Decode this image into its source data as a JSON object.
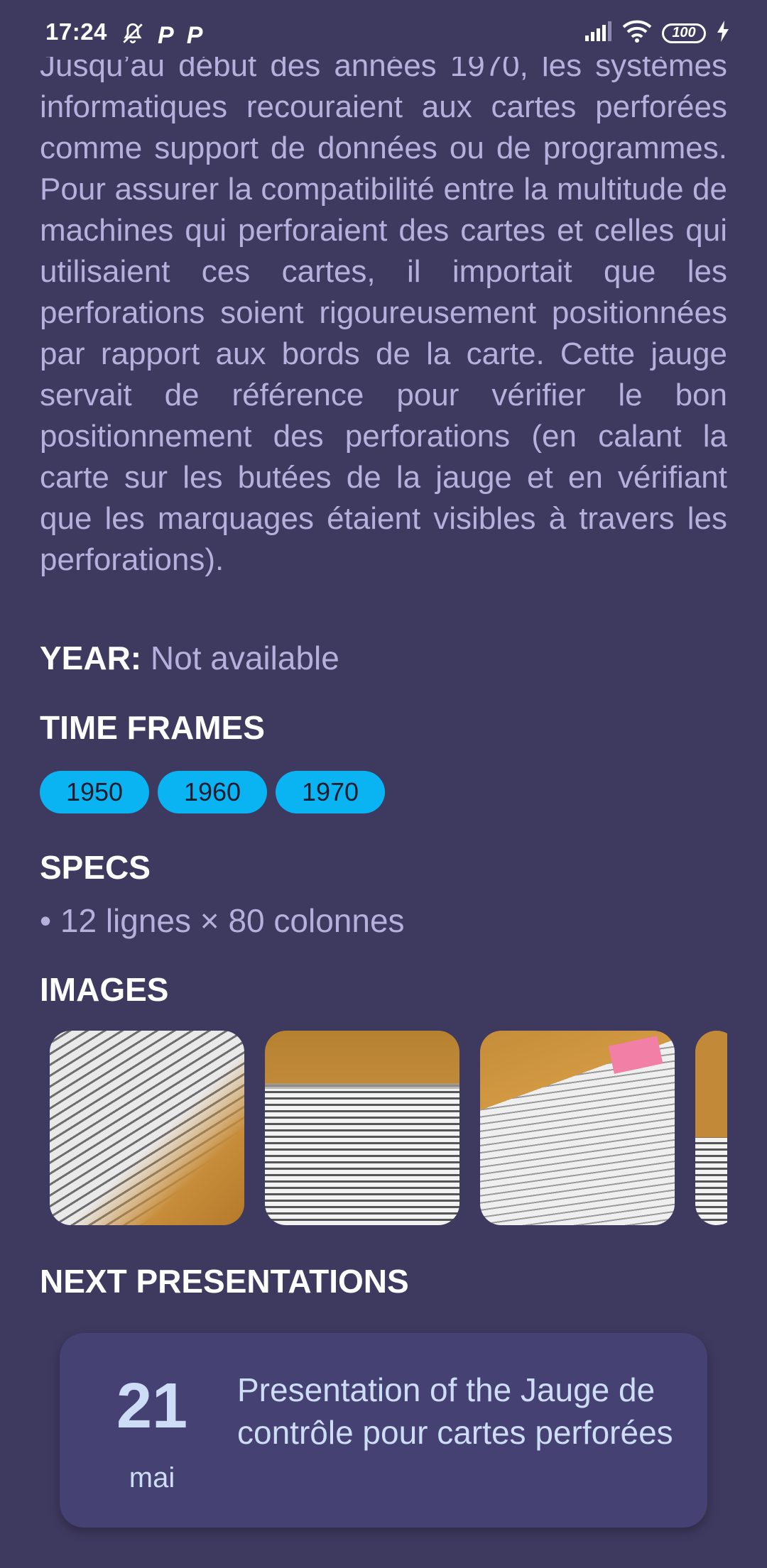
{
  "status_bar": {
    "time": "17:24",
    "battery": "100",
    "icons": [
      "mute-icon",
      "parking-icon",
      "parking-icon",
      "signal-icon",
      "wifi-icon",
      "battery-icon",
      "charging-icon"
    ]
  },
  "description": "Jusqu’au début des années 1970, les systèmes informatiques recouraient aux cartes perforées comme support de données ou de programmes. Pour assurer la compatibilité entre la multitude de machines qui perforaient des cartes et celles qui utilisaient ces cartes, il importait que les perforations soient rigoureusement positionnées par rapport aux bords de la carte. Cette jauge servait de référence pour vérifier le bon positionnement des perforations (en calant la carte sur les butées de la jauge et en vérifiant que les marquages étaient visibles à travers les perforations).",
  "year": {
    "label": "YEAR:",
    "value": "Not available"
  },
  "time_frames": {
    "title": "TIME FRAMES",
    "items": [
      "1950",
      "1960",
      "1970"
    ]
  },
  "specs": {
    "title": "SPECS",
    "items": [
      "• 12 lignes × 80 colonnes"
    ]
  },
  "images": {
    "title": "IMAGES"
  },
  "next_presentations": {
    "title": "NEXT PRESENTATIONS",
    "items": [
      {
        "day": "21",
        "month": "mai",
        "title": "Presentation of the Jauge de contrôle pour cartes perforées"
      }
    ]
  },
  "colors": {
    "background": "#3e395f",
    "chip": "#0ab4f2",
    "card": "#454172",
    "text_muted": "#b6b1dc"
  }
}
